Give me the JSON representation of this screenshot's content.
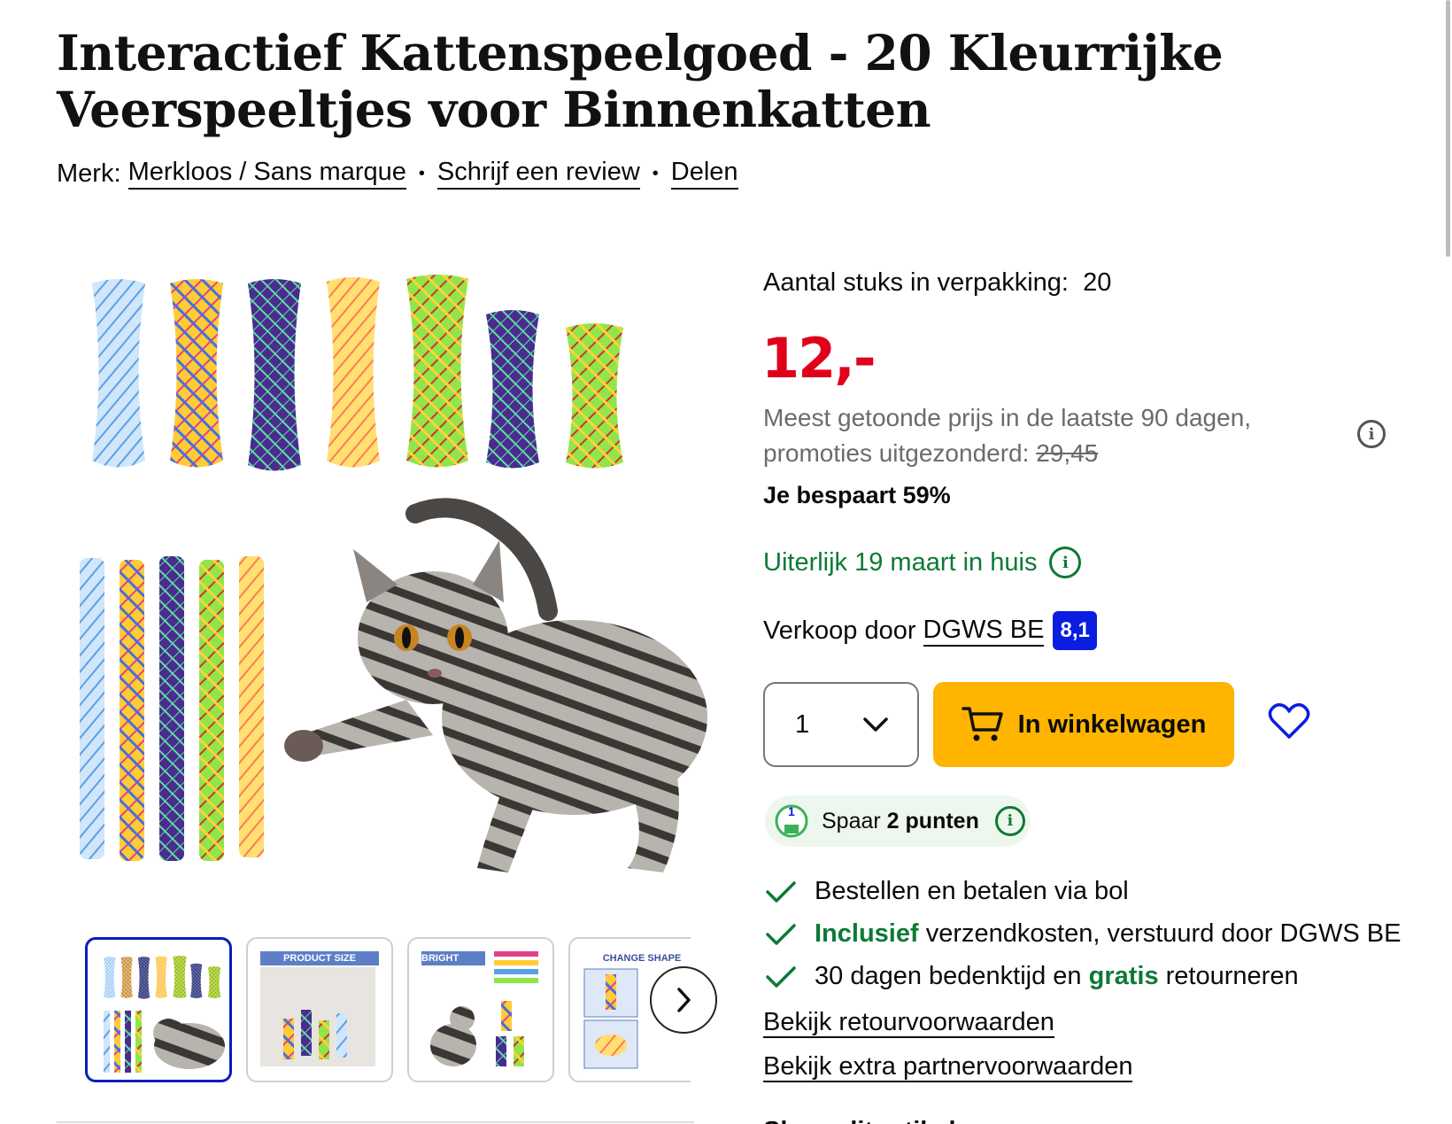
{
  "product": {
    "title": "Interactief Kattenspeelgoed - 20 Kleurrijke Veerspeeltjes voor Binnenkatten",
    "brand_label": "Merk:",
    "brand": "Merkloos / Sans marque",
    "review_link": "Schrijf een review",
    "share_link": "Delen"
  },
  "offer": {
    "pack_label": "Aantal stuks in verpakking:",
    "pack_value": "20",
    "price": "12,-",
    "ref_text": "Meest getoonde prijs in de laatste 90 dagen, promoties uitgezonderd:",
    "ref_price": "29,45",
    "saving": "Je bespaart 59%",
    "delivery": "Uiterlijk 19 maart in huis",
    "seller_label": "Verkoop door",
    "seller": "DGWS BE",
    "seller_score": "8,1",
    "quantity": "1",
    "cart_label": "In winkelwagen",
    "points_prefix": "Spaar",
    "points_value": "2 punten",
    "points_badge": "1"
  },
  "usps": [
    {
      "pre": "",
      "hl": "",
      "post": "Bestellen en betalen via bol"
    },
    {
      "pre": "",
      "hl": "Inclusief",
      "post": " verzendkosten, verstuurd door DGWS BE"
    },
    {
      "pre": "30 dagen bedenktijd en ",
      "hl": "gratis",
      "post": " retourneren"
    }
  ],
  "links": {
    "returns": "Bekijk retourvoorwaarden",
    "partner": "Bekijk extra partnervoorwaarden",
    "cut_heading": "Share dit artikel"
  },
  "thumbnails": [
    {
      "caption": ""
    },
    {
      "caption": "PRODUCT SIZE"
    },
    {
      "caption": "BRIGHT COLORS"
    },
    {
      "caption": "CHANGE SHAPE"
    }
  ],
  "colors": {
    "price": "#e0001a",
    "cart_button": "#ffb400",
    "delivery_green": "#0c7a36",
    "score_blue": "#0a1de0",
    "active_thumb": "#0a1db8"
  },
  "icons": [
    "info-icon",
    "chevron-down-icon",
    "cart-icon",
    "heart-icon",
    "check-icon",
    "chevron-right-icon",
    "points-icon"
  ]
}
